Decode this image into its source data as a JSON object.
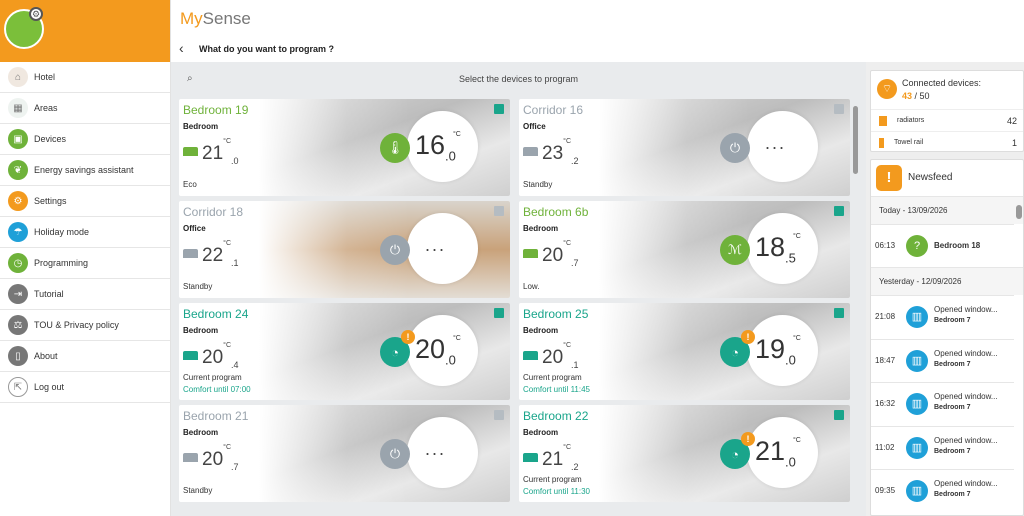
{
  "app": {
    "brand_a": "My",
    "brand_b": "Sense",
    "page_title": "What do you want to program ?",
    "accent": "#f39a1e",
    "green": "#1aa58b"
  },
  "sidebar": {
    "items": [
      {
        "label": "Hotel",
        "icon": "home-icon",
        "color": "#f0e8e0"
      },
      {
        "label": "Areas",
        "icon": "grid-icon",
        "color": "#eef3f0"
      },
      {
        "label": "Devices",
        "icon": "devices-icon",
        "color": "#6fb23a"
      },
      {
        "label": "Energy savings assistant",
        "icon": "leaf-icon",
        "color": "#6fb23a"
      },
      {
        "label": "Settings",
        "icon": "gear-icon",
        "color": "#f39a1e"
      },
      {
        "label": "Holiday mode",
        "icon": "beach-icon",
        "color": "#1fa0d8"
      },
      {
        "label": "Programming",
        "icon": "clock-icon",
        "color": "#6fb23a"
      },
      {
        "label": "Tutorial",
        "icon": "signpost-icon",
        "color": "#777"
      },
      {
        "label": "TOU & Privacy policy",
        "icon": "scales-icon",
        "color": "#777"
      },
      {
        "label": "About",
        "icon": "phone-icon",
        "color": "#777"
      },
      {
        "label": "Log out",
        "icon": "logout-icon",
        "color": "#fff"
      }
    ]
  },
  "main": {
    "select_hint": "Select the devices to program",
    "cards": [
      {
        "name": "Bedroom 19",
        "type": "Bedroom",
        "amb_int": "21",
        "amb_dec": ".0",
        "status": "Eco",
        "set_int": "16",
        "set_dec": ".0",
        "mode": "thermometer-icon",
        "mode_color": "#6fb23a",
        "name_color": "#6fb23a"
      },
      {
        "name": "Corridor 16",
        "type": "Office",
        "amb_int": "23",
        "amb_dec": ".2",
        "status": "Standby",
        "dots": "...",
        "mode": "power-icon",
        "mode_color": "#9aa4ad",
        "name_color": "#9aa4ad"
      },
      {
        "name": "Corridor 18",
        "type": "Office",
        "amb_int": "22",
        "amb_dec": ".1",
        "status": "Standby",
        "dots": "...",
        "mode": "power-icon",
        "mode_color": "#9aa4ad",
        "name_color": "#9aa4ad"
      },
      {
        "name": "Bedroom 6b",
        "type": "Bedroom",
        "amb_int": "20",
        "amb_dec": ".7",
        "status": "Low.",
        "set_int": "18",
        "set_dec": ".5",
        "mode": "tree-icon",
        "mode_color": "#6fb23a",
        "name_color": "#6fb23a"
      },
      {
        "name": "Bedroom 24",
        "type": "Bedroom",
        "amb_int": "20",
        "amb_dec": ".4",
        "prog": "Current program",
        "until": "Comfort until 07:00",
        "set_int": "20",
        "set_dec": ".0",
        "mode": "schedule-icon",
        "mode_color": "#1aa58b",
        "name_color": "#1aa58b",
        "alert": "!"
      },
      {
        "name": "Bedroom 25",
        "type": "Bedroom",
        "amb_int": "20",
        "amb_dec": ".1",
        "prog": "Current program",
        "until": "Comfort until 11:45",
        "set_int": "19",
        "set_dec": ".0",
        "mode": "schedule-icon",
        "mode_color": "#1aa58b",
        "name_color": "#1aa58b",
        "alert": "!"
      },
      {
        "name": "Bedroom 21",
        "type": "Bedroom",
        "amb_int": "20",
        "amb_dec": ".7",
        "status": "Standby",
        "dots": "...",
        "mode": "power-icon",
        "mode_color": "#9aa4ad",
        "name_color": "#9aa4ad"
      },
      {
        "name": "Bedroom 22",
        "type": "Bedroom",
        "amb_int": "21",
        "amb_dec": ".2",
        "prog": "Current program",
        "until": "Comfort until 11:30",
        "set_int": "21",
        "set_dec": ".0",
        "mode": "schedule-icon",
        "mode_color": "#1aa58b",
        "name_color": "#1aa58b",
        "alert": "!"
      }
    ],
    "unit": "°C"
  },
  "right": {
    "connected_label": "Connected devices:",
    "connected_count": "43",
    "connected_total": "/ 50",
    "rows": [
      {
        "label": "radiators",
        "count": "42"
      },
      {
        "label": "Towel rail",
        "count": "1"
      }
    ],
    "newsfeed_title": "Newsfeed",
    "today": "Today - 13/09/2026",
    "yesterday": "Yesterday - 12/09/2026",
    "feed": [
      {
        "time": "06:13",
        "l1": "Bedroom 18",
        "l2": "",
        "icon": "question-icon",
        "color": "#6fb23a"
      },
      {
        "time": "21:08",
        "l1": "Opened window...",
        "l2": "Bedroom 7",
        "icon": "window-icon",
        "color": "#1fa0d8"
      },
      {
        "time": "18:47",
        "l1": "Opened window...",
        "l2": "Bedroom 7",
        "icon": "window-icon",
        "color": "#1fa0d8"
      },
      {
        "time": "16:32",
        "l1": "Opened window...",
        "l2": "Bedroom 7",
        "icon": "window-icon",
        "color": "#1fa0d8"
      },
      {
        "time": "11:02",
        "l1": "Opened window...",
        "l2": "Bedroom 7",
        "icon": "window-icon",
        "color": "#1fa0d8"
      },
      {
        "time": "09:35",
        "l1": "Opened window...",
        "l2": "Bedroom 7",
        "icon": "window-icon",
        "color": "#1fa0d8"
      }
    ]
  }
}
